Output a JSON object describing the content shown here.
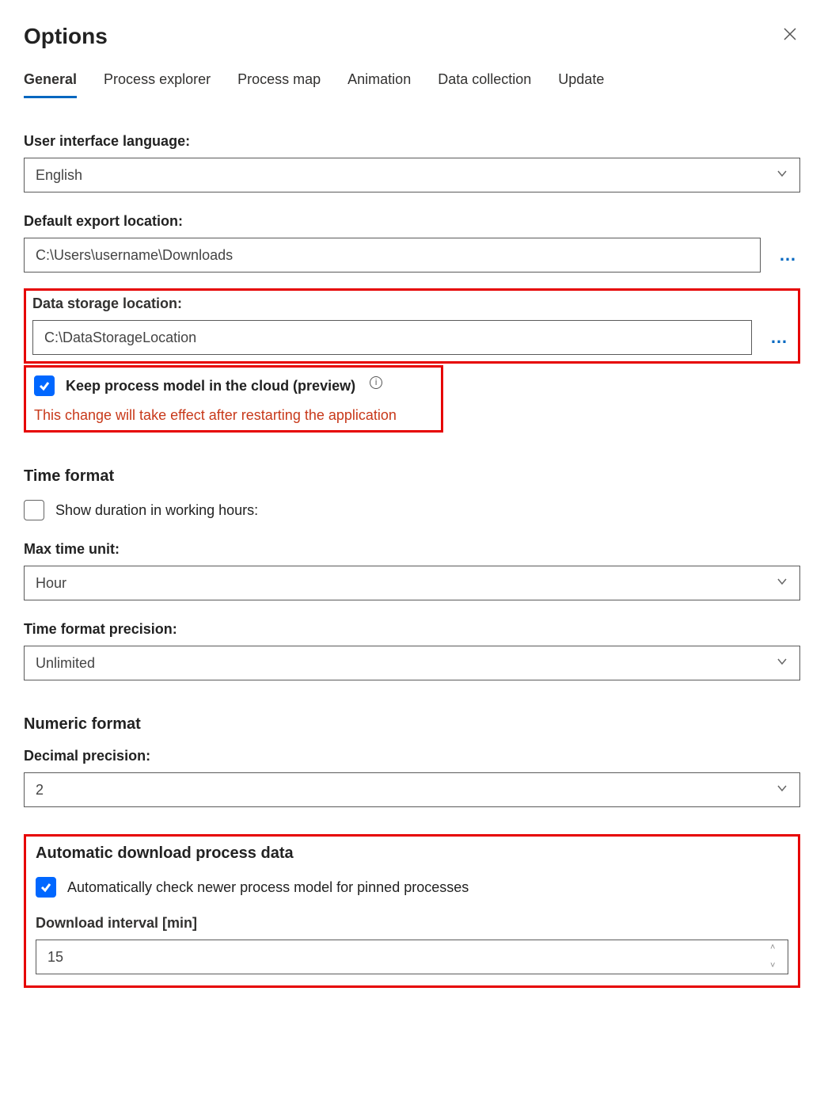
{
  "header": {
    "title": "Options"
  },
  "tabs": [
    {
      "label": "General",
      "active": true
    },
    {
      "label": "Process explorer",
      "active": false
    },
    {
      "label": "Process map",
      "active": false
    },
    {
      "label": "Animation",
      "active": false
    },
    {
      "label": "Data collection",
      "active": false
    },
    {
      "label": "Update",
      "active": false
    }
  ],
  "general": {
    "ui_language_label": "User interface language:",
    "ui_language_value": "English",
    "export_location_label": "Default export location:",
    "export_location_value": "C:\\Users\\username\\Downloads",
    "data_storage_label": "Data storage location:",
    "data_storage_value": "C:\\DataStorageLocation",
    "keep_cloud_label": "Keep process model in the cloud (preview)",
    "keep_cloud_checked": true,
    "restart_warning": "This change will take effect after restarting the application"
  },
  "time_format": {
    "heading": "Time format",
    "show_duration_label": "Show duration in working hours:",
    "show_duration_checked": false,
    "max_unit_label": "Max time unit:",
    "max_unit_value": "Hour",
    "precision_label": "Time format precision:",
    "precision_value": "Unlimited"
  },
  "numeric_format": {
    "heading": "Numeric format",
    "decimal_label": "Decimal precision:",
    "decimal_value": "2"
  },
  "auto_download": {
    "heading": "Automatic download process data",
    "auto_check_label": "Automatically check newer process model for pinned processes",
    "auto_check_checked": true,
    "interval_label": "Download interval [min]",
    "interval_value": "15"
  }
}
